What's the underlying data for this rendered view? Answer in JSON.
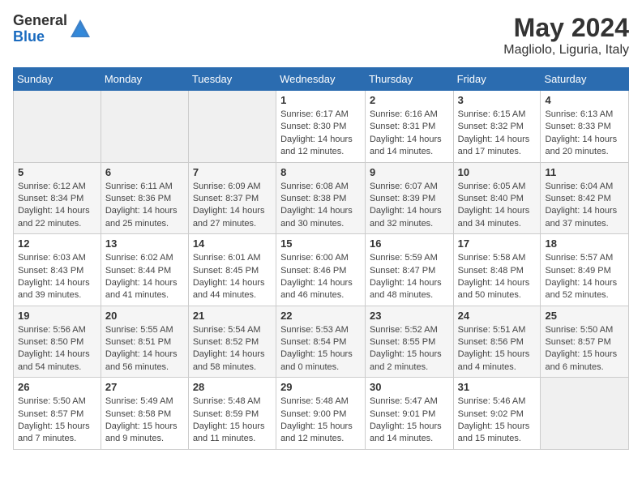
{
  "header": {
    "logo_general": "General",
    "logo_blue": "Blue",
    "month_title": "May 2024",
    "location": "Magliolo, Liguria, Italy"
  },
  "weekdays": [
    "Sunday",
    "Monday",
    "Tuesday",
    "Wednesday",
    "Thursday",
    "Friday",
    "Saturday"
  ],
  "weeks": [
    [
      {
        "day": "",
        "empty": true
      },
      {
        "day": "",
        "empty": true
      },
      {
        "day": "",
        "empty": true
      },
      {
        "day": "1",
        "sunrise": "Sunrise: 6:17 AM",
        "sunset": "Sunset: 8:30 PM",
        "daylight": "Daylight: 14 hours and 12 minutes."
      },
      {
        "day": "2",
        "sunrise": "Sunrise: 6:16 AM",
        "sunset": "Sunset: 8:31 PM",
        "daylight": "Daylight: 14 hours and 14 minutes."
      },
      {
        "day": "3",
        "sunrise": "Sunrise: 6:15 AM",
        "sunset": "Sunset: 8:32 PM",
        "daylight": "Daylight: 14 hours and 17 minutes."
      },
      {
        "day": "4",
        "sunrise": "Sunrise: 6:13 AM",
        "sunset": "Sunset: 8:33 PM",
        "daylight": "Daylight: 14 hours and 20 minutes."
      }
    ],
    [
      {
        "day": "5",
        "sunrise": "Sunrise: 6:12 AM",
        "sunset": "Sunset: 8:34 PM",
        "daylight": "Daylight: 14 hours and 22 minutes."
      },
      {
        "day": "6",
        "sunrise": "Sunrise: 6:11 AM",
        "sunset": "Sunset: 8:36 PM",
        "daylight": "Daylight: 14 hours and 25 minutes."
      },
      {
        "day": "7",
        "sunrise": "Sunrise: 6:09 AM",
        "sunset": "Sunset: 8:37 PM",
        "daylight": "Daylight: 14 hours and 27 minutes."
      },
      {
        "day": "8",
        "sunrise": "Sunrise: 6:08 AM",
        "sunset": "Sunset: 8:38 PM",
        "daylight": "Daylight: 14 hours and 30 minutes."
      },
      {
        "day": "9",
        "sunrise": "Sunrise: 6:07 AM",
        "sunset": "Sunset: 8:39 PM",
        "daylight": "Daylight: 14 hours and 32 minutes."
      },
      {
        "day": "10",
        "sunrise": "Sunrise: 6:05 AM",
        "sunset": "Sunset: 8:40 PM",
        "daylight": "Daylight: 14 hours and 34 minutes."
      },
      {
        "day": "11",
        "sunrise": "Sunrise: 6:04 AM",
        "sunset": "Sunset: 8:42 PM",
        "daylight": "Daylight: 14 hours and 37 minutes."
      }
    ],
    [
      {
        "day": "12",
        "sunrise": "Sunrise: 6:03 AM",
        "sunset": "Sunset: 8:43 PM",
        "daylight": "Daylight: 14 hours and 39 minutes."
      },
      {
        "day": "13",
        "sunrise": "Sunrise: 6:02 AM",
        "sunset": "Sunset: 8:44 PM",
        "daylight": "Daylight: 14 hours and 41 minutes."
      },
      {
        "day": "14",
        "sunrise": "Sunrise: 6:01 AM",
        "sunset": "Sunset: 8:45 PM",
        "daylight": "Daylight: 14 hours and 44 minutes."
      },
      {
        "day": "15",
        "sunrise": "Sunrise: 6:00 AM",
        "sunset": "Sunset: 8:46 PM",
        "daylight": "Daylight: 14 hours and 46 minutes."
      },
      {
        "day": "16",
        "sunrise": "Sunrise: 5:59 AM",
        "sunset": "Sunset: 8:47 PM",
        "daylight": "Daylight: 14 hours and 48 minutes."
      },
      {
        "day": "17",
        "sunrise": "Sunrise: 5:58 AM",
        "sunset": "Sunset: 8:48 PM",
        "daylight": "Daylight: 14 hours and 50 minutes."
      },
      {
        "day": "18",
        "sunrise": "Sunrise: 5:57 AM",
        "sunset": "Sunset: 8:49 PM",
        "daylight": "Daylight: 14 hours and 52 minutes."
      }
    ],
    [
      {
        "day": "19",
        "sunrise": "Sunrise: 5:56 AM",
        "sunset": "Sunset: 8:50 PM",
        "daylight": "Daylight: 14 hours and 54 minutes."
      },
      {
        "day": "20",
        "sunrise": "Sunrise: 5:55 AM",
        "sunset": "Sunset: 8:51 PM",
        "daylight": "Daylight: 14 hours and 56 minutes."
      },
      {
        "day": "21",
        "sunrise": "Sunrise: 5:54 AM",
        "sunset": "Sunset: 8:52 PM",
        "daylight": "Daylight: 14 hours and 58 minutes."
      },
      {
        "day": "22",
        "sunrise": "Sunrise: 5:53 AM",
        "sunset": "Sunset: 8:54 PM",
        "daylight": "Daylight: 15 hours and 0 minutes."
      },
      {
        "day": "23",
        "sunrise": "Sunrise: 5:52 AM",
        "sunset": "Sunset: 8:55 PM",
        "daylight": "Daylight: 15 hours and 2 minutes."
      },
      {
        "day": "24",
        "sunrise": "Sunrise: 5:51 AM",
        "sunset": "Sunset: 8:56 PM",
        "daylight": "Daylight: 15 hours and 4 minutes."
      },
      {
        "day": "25",
        "sunrise": "Sunrise: 5:50 AM",
        "sunset": "Sunset: 8:57 PM",
        "daylight": "Daylight: 15 hours and 6 minutes."
      }
    ],
    [
      {
        "day": "26",
        "sunrise": "Sunrise: 5:50 AM",
        "sunset": "Sunset: 8:57 PM",
        "daylight": "Daylight: 15 hours and 7 minutes."
      },
      {
        "day": "27",
        "sunrise": "Sunrise: 5:49 AM",
        "sunset": "Sunset: 8:58 PM",
        "daylight": "Daylight: 15 hours and 9 minutes."
      },
      {
        "day": "28",
        "sunrise": "Sunrise: 5:48 AM",
        "sunset": "Sunset: 8:59 PM",
        "daylight": "Daylight: 15 hours and 11 minutes."
      },
      {
        "day": "29",
        "sunrise": "Sunrise: 5:48 AM",
        "sunset": "Sunset: 9:00 PM",
        "daylight": "Daylight: 15 hours and 12 minutes."
      },
      {
        "day": "30",
        "sunrise": "Sunrise: 5:47 AM",
        "sunset": "Sunset: 9:01 PM",
        "daylight": "Daylight: 15 hours and 14 minutes."
      },
      {
        "day": "31",
        "sunrise": "Sunrise: 5:46 AM",
        "sunset": "Sunset: 9:02 PM",
        "daylight": "Daylight: 15 hours and 15 minutes."
      },
      {
        "day": "",
        "empty": true
      }
    ]
  ]
}
